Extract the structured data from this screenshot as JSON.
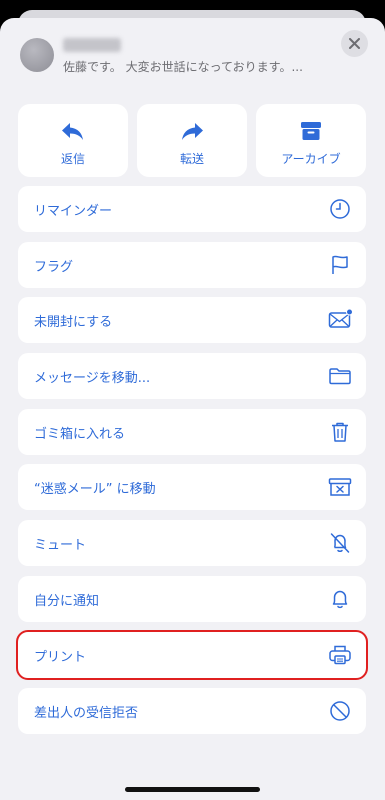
{
  "header": {
    "preview": "佐藤です。 大変お世話になっております。..."
  },
  "quick_actions": [
    {
      "label": "返信",
      "icon": "reply-icon"
    },
    {
      "label": "転送",
      "icon": "forward-icon"
    },
    {
      "label": "アーカイブ",
      "icon": "archive-icon"
    }
  ],
  "menu": [
    {
      "label": "リマインダー",
      "icon": "clock-icon"
    },
    {
      "label": "フラグ",
      "icon": "flag-icon"
    },
    {
      "label": "未開封にする",
      "icon": "envelope-unread-icon"
    },
    {
      "label": "メッセージを移動...",
      "icon": "folder-icon"
    },
    {
      "label": "ゴミ箱に入れる",
      "icon": "trash-icon"
    },
    {
      "label": "“迷惑メール” に移動",
      "icon": "junk-icon"
    },
    {
      "label": "ミュート",
      "icon": "bell-slash-icon"
    },
    {
      "label": "自分に通知",
      "icon": "bell-icon"
    },
    {
      "label": "プリント",
      "icon": "printer-icon"
    },
    {
      "label": "差出人の受信拒否",
      "icon": "block-icon"
    }
  ],
  "colors": {
    "accent": "#2f6bd8",
    "highlight": "#e02020",
    "sheet_bg": "#f1f1f5"
  }
}
